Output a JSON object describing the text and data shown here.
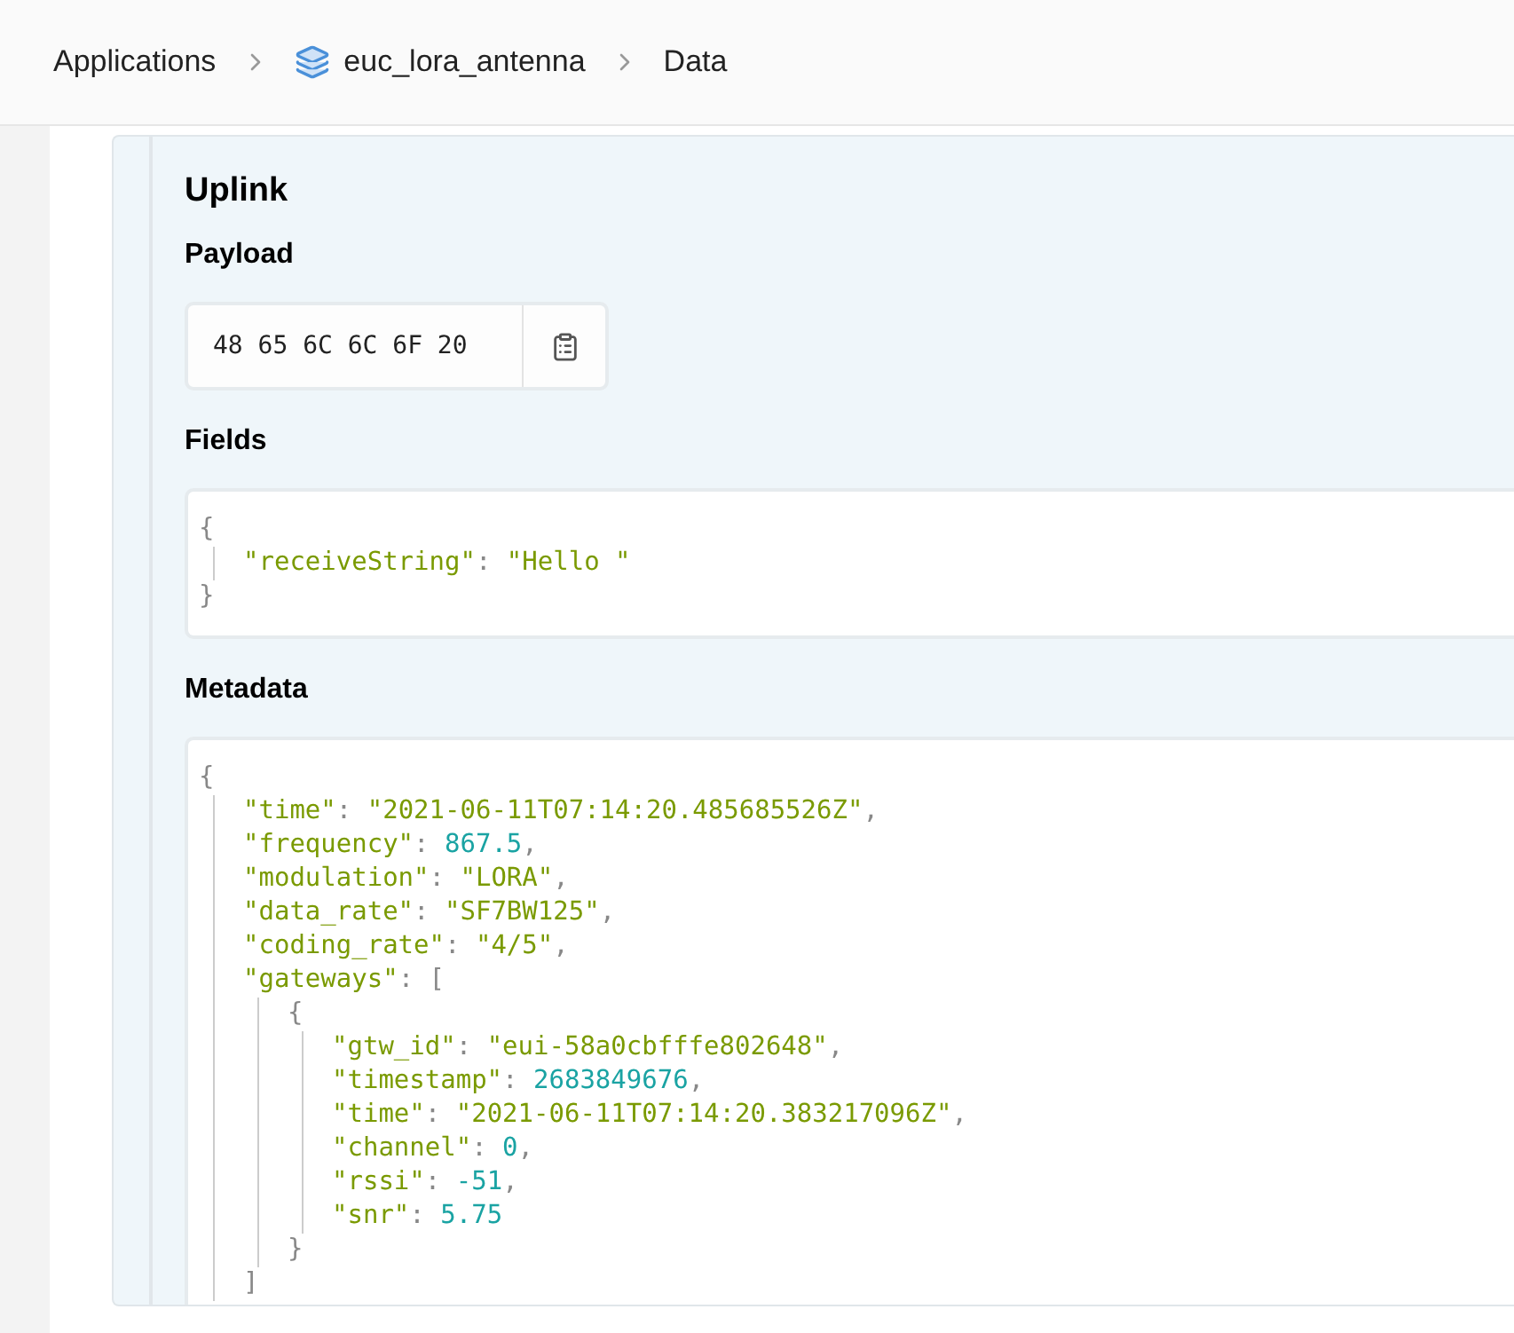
{
  "breadcrumb": [
    {
      "label": "Applications",
      "kind": "plain"
    },
    {
      "label": "euc_lora_antenna",
      "kind": "application"
    },
    {
      "label": "Data",
      "kind": "plain"
    }
  ],
  "section": {
    "title": "Uplink",
    "payload": {
      "label": "Payload",
      "value": "48 65 6C 6C 6F 20"
    },
    "fields": {
      "label": "Fields",
      "lines": [
        {
          "tokens": [
            {
              "kind": "punct",
              "text": "{"
            }
          ],
          "children": [
            {
              "tokens": [
                {
                  "kind": "key",
                  "text": "\"receiveString\""
                },
                {
                  "kind": "punct",
                  "text": ": "
                },
                {
                  "kind": "string",
                  "text": "\"Hello \""
                }
              ]
            }
          ]
        },
        {
          "tokens": [
            {
              "kind": "punct",
              "text": "}"
            }
          ]
        }
      ]
    },
    "metadata": {
      "label": "Metadata",
      "lines": [
        {
          "tokens": [
            {
              "kind": "punct",
              "text": "{"
            }
          ],
          "children": [
            {
              "tokens": [
                {
                  "kind": "key",
                  "text": "\"time\""
                },
                {
                  "kind": "punct",
                  "text": ": "
                },
                {
                  "kind": "string",
                  "text": "\"2021-06-11T07:14:20.485685526Z\""
                },
                {
                  "kind": "punct",
                  "text": ","
                }
              ]
            },
            {
              "tokens": [
                {
                  "kind": "key",
                  "text": "\"frequency\""
                },
                {
                  "kind": "punct",
                  "text": ": "
                },
                {
                  "kind": "number",
                  "text": "867.5"
                },
                {
                  "kind": "punct",
                  "text": ","
                }
              ]
            },
            {
              "tokens": [
                {
                  "kind": "key",
                  "text": "\"modulation\""
                },
                {
                  "kind": "punct",
                  "text": ": "
                },
                {
                  "kind": "string",
                  "text": "\"LORA\""
                },
                {
                  "kind": "punct",
                  "text": ","
                }
              ]
            },
            {
              "tokens": [
                {
                  "kind": "key",
                  "text": "\"data_rate\""
                },
                {
                  "kind": "punct",
                  "text": ": "
                },
                {
                  "kind": "string",
                  "text": "\"SF7BW125\""
                },
                {
                  "kind": "punct",
                  "text": ","
                }
              ]
            },
            {
              "tokens": [
                {
                  "kind": "key",
                  "text": "\"coding_rate\""
                },
                {
                  "kind": "punct",
                  "text": ": "
                },
                {
                  "kind": "string",
                  "text": "\"4/5\""
                },
                {
                  "kind": "punct",
                  "text": ","
                }
              ]
            },
            {
              "tokens": [
                {
                  "kind": "key",
                  "text": "\"gateways\""
                },
                {
                  "kind": "punct",
                  "text": ": ["
                }
              ],
              "children": [
                {
                  "tokens": [
                    {
                      "kind": "punct",
                      "text": "{"
                    }
                  ],
                  "children": [
                    {
                      "tokens": [
                        {
                          "kind": "key",
                          "text": "\"gtw_id\""
                        },
                        {
                          "kind": "punct",
                          "text": ": "
                        },
                        {
                          "kind": "string",
                          "text": "\"eui-58a0cbfffe802648\""
                        },
                        {
                          "kind": "punct",
                          "text": ","
                        }
                      ]
                    },
                    {
                      "tokens": [
                        {
                          "kind": "key",
                          "text": "\"timestamp\""
                        },
                        {
                          "kind": "punct",
                          "text": ": "
                        },
                        {
                          "kind": "number",
                          "text": "2683849676"
                        },
                        {
                          "kind": "punct",
                          "text": ","
                        }
                      ]
                    },
                    {
                      "tokens": [
                        {
                          "kind": "key",
                          "text": "\"time\""
                        },
                        {
                          "kind": "punct",
                          "text": ": "
                        },
                        {
                          "kind": "string",
                          "text": "\"2021-06-11T07:14:20.383217096Z\""
                        },
                        {
                          "kind": "punct",
                          "text": ","
                        }
                      ]
                    },
                    {
                      "tokens": [
                        {
                          "kind": "key",
                          "text": "\"channel\""
                        },
                        {
                          "kind": "punct",
                          "text": ": "
                        },
                        {
                          "kind": "number",
                          "text": "0"
                        },
                        {
                          "kind": "punct",
                          "text": ","
                        }
                      ]
                    },
                    {
                      "tokens": [
                        {
                          "kind": "key",
                          "text": "\"rssi\""
                        },
                        {
                          "kind": "punct",
                          "text": ": "
                        },
                        {
                          "kind": "number",
                          "text": "-51"
                        },
                        {
                          "kind": "punct",
                          "text": ","
                        }
                      ]
                    },
                    {
                      "tokens": [
                        {
                          "kind": "key",
                          "text": "\"snr\""
                        },
                        {
                          "kind": "punct",
                          "text": ": "
                        },
                        {
                          "kind": "number",
                          "text": "5.75"
                        }
                      ]
                    }
                  ]
                },
                {
                  "tokens": [
                    {
                      "kind": "punct",
                      "text": "}"
                    }
                  ]
                }
              ]
            },
            {
              "tokens": [
                {
                  "kind": "punct",
                  "text": "]"
                }
              ]
            }
          ]
        }
      ]
    }
  }
}
